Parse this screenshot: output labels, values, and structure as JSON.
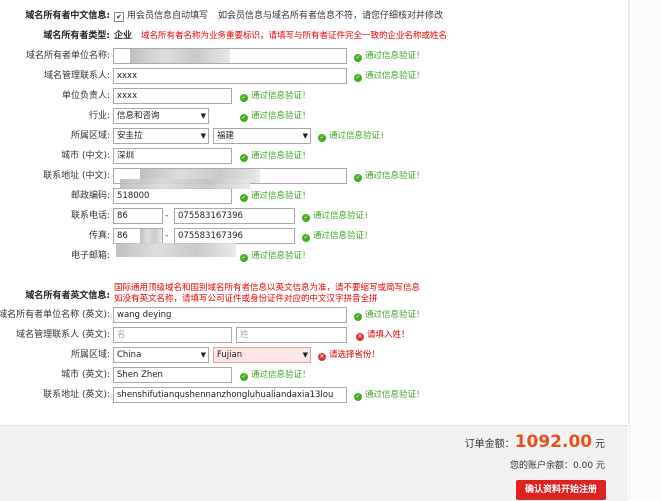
{
  "colors": {
    "accent": "#e00000",
    "ok": "#36a71f",
    "amount": "#e8501f",
    "submit": "#dd2222"
  },
  "cn": {
    "section_title": "域名所有者中文信息:",
    "use_member_checkbox_mark": "✔",
    "use_member_label": "用会员信息自动填写",
    "use_member_hint": "如会员信息与域名所有者信息不符，请您仔细核对并修改",
    "owner_type_label": "域名所有者类型:",
    "owner_type_value": "企业",
    "owner_type_note": "域名所有者名称为业务重要标识，请填写与所有者证件完全一致的企业名称或姓名",
    "org_label": "域名所有者单位名称:",
    "admin_label": "域名管理联系人:",
    "admin_value": "xxxx",
    "principal_label": "单位负责人:",
    "principal_value": "xxxx",
    "industry_label": "行业:",
    "industry_value": "信息和咨询",
    "region_label": "所属区域:",
    "region_country": "安圭拉",
    "region_province": "福建",
    "city_label": "城市 (中文):",
    "city_value": "深圳",
    "address_label": "联系地址 (中文):",
    "zip_label": "邮政编码:",
    "zip_value": "518000",
    "phone_label": "联系电话:",
    "phone_code": "86",
    "phone_number": "075583167396",
    "fax_label": "传真:",
    "fax_code": "86",
    "fax_number": "075583167396",
    "email_label": "电子邮箱:",
    "dash": "-"
  },
  "en": {
    "section_title": "域名所有者英文信息:",
    "note_line1": "国际通用顶级域名和国别域名所有者信息以英文信息为准，请不要缩写或简写信息",
    "note_line2": "如没有英文名称，请填写公司证件或身份证件对应的中文汉字拼音全拼",
    "org_label": "域名所有者单位名称 (英文):",
    "org_value": "wang deying",
    "contact_label": "域名管理联系人 (英文):",
    "contact_first_placeholder": "名",
    "contact_last_placeholder": "姓",
    "contact_error": "请填入姓！",
    "region_label": "所属区域:",
    "region_country": "China",
    "region_province": "Fujian",
    "region_error": "请选择省份！",
    "city_label": "城市 (英文):",
    "city_value": "Shen Zhen",
    "address_label": "联系地址 (英文):",
    "address_value": "shenshifutianqushennanzhongluhualiandaxia13lou"
  },
  "verified_text": "通过信息验证！",
  "verified_icon": "check-icon",
  "error_icon": "close-icon",
  "order": {
    "amount_label": "订单金额：",
    "amount": "1092.00",
    "currency": "元",
    "balance_label": "您的账户余额：",
    "balance": "0.00",
    "balance_currency": "元",
    "submit_label": "确认资料开始注册"
  }
}
